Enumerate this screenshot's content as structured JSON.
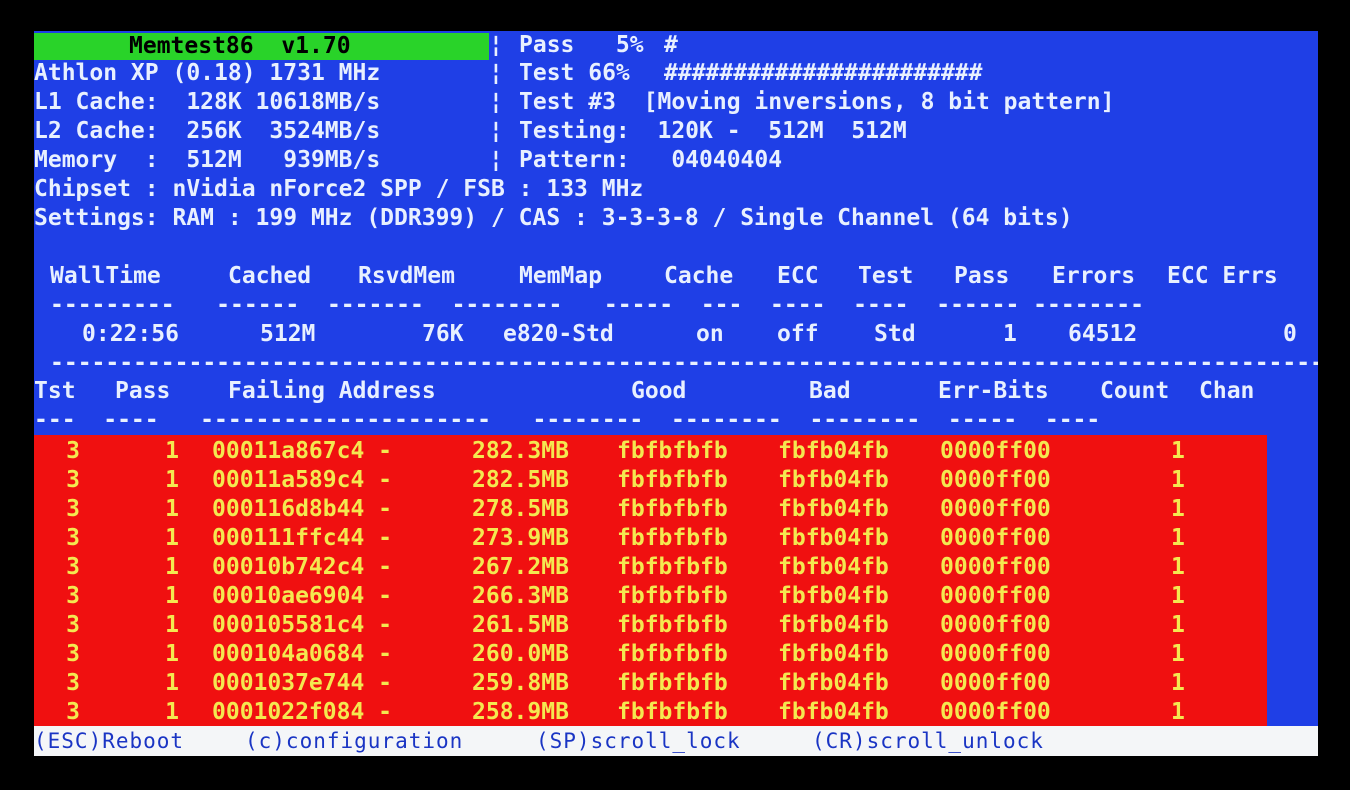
{
  "title": "Memtest86  v1.70",
  "sysinfo": {
    "cpu": "Athlon XP (0.18) 1731 MHz",
    "l1": "L1 Cache:  128K 10618MB/s",
    "l2": "L2 Cache:  256K  3524MB/s",
    "memory": "Memory  :  512M   939MB/s",
    "chipset": "Chipset : nVidia nForce2 SPP / FSB : 133 MHz",
    "settings": "Settings: RAM : 199 MHz (DDR399) / CAS : 3-3-3-8 / Single Channel (64 bits)"
  },
  "progress": {
    "pass_label": "Pass   5%",
    "pass_bar": "#",
    "pass_percent": 5,
    "test_label": "Test 66%",
    "test_bar": "#######################",
    "test_percent": 66,
    "test_name": "Test #3  [Moving inversions, 8 bit pattern]",
    "testing": "Testing:  120K -  512M  512M",
    "pattern": "Pattern:   04040404"
  },
  "status": {
    "headers": [
      "WallTime",
      "Cached",
      "RsvdMem",
      "MemMap",
      "Cache",
      "ECC",
      "Test",
      "Pass",
      "Errors",
      "ECC Errs"
    ],
    "values": [
      "0:22:56",
      "512M",
      "76K",
      "e820-Std",
      "on",
      "off",
      "Std",
      "1",
      "64512",
      "0"
    ]
  },
  "errors": {
    "headers": [
      "Tst",
      "Pass",
      "Failing Address",
      "Good",
      "Bad",
      "Err-Bits",
      "Count",
      "Chan"
    ],
    "rows": [
      [
        "3",
        "1",
        "00011a867c4 -",
        "282.3MB",
        "fbfbfbfb",
        "fbfb04fb",
        "0000ff00",
        "1"
      ],
      [
        "3",
        "1",
        "00011a589c4 -",
        "282.5MB",
        "fbfbfbfb",
        "fbfb04fb",
        "0000ff00",
        "1"
      ],
      [
        "3",
        "1",
        "000116d8b44 -",
        "278.5MB",
        "fbfbfbfb",
        "fbfb04fb",
        "0000ff00",
        "1"
      ],
      [
        "3",
        "1",
        "000111ffc44 -",
        "273.9MB",
        "fbfbfbfb",
        "fbfb04fb",
        "0000ff00",
        "1"
      ],
      [
        "3",
        "1",
        "00010b742c4 -",
        "267.2MB",
        "fbfbfbfb",
        "fbfb04fb",
        "0000ff00",
        "1"
      ],
      [
        "3",
        "1",
        "00010ae6904 -",
        "266.3MB",
        "fbfbfbfb",
        "fbfb04fb",
        "0000ff00",
        "1"
      ],
      [
        "3",
        "1",
        "000105581c4 -",
        "261.5MB",
        "fbfbfbfb",
        "fbfb04fb",
        "0000ff00",
        "1"
      ],
      [
        "3",
        "1",
        "000104a0684 -",
        "260.0MB",
        "fbfbfbfb",
        "fbfb04fb",
        "0000ff00",
        "1"
      ],
      [
        "3",
        "1",
        "0001037e744 -",
        "259.8MB",
        "fbfbfbfb",
        "fbfb04fb",
        "0000ff00",
        "1"
      ],
      [
        "3",
        "1",
        "0001022f084 -",
        "258.9MB",
        "fbfbfbfb",
        "fbfb04fb",
        "0000ff00",
        "1"
      ]
    ]
  },
  "footer": {
    "reboot": "(ESC)Reboot",
    "config": "(c)configuration",
    "scroll_lock": "(SP)scroll_lock",
    "scroll_unlock": "(CR)scroll_unlock"
  },
  "colors": {
    "screen_bg": "#1f3fe6",
    "banner_bg": "#29d329",
    "error_bg": "#f01010",
    "error_text": "#f4e850",
    "footer_bg": "#f4f6f8"
  }
}
